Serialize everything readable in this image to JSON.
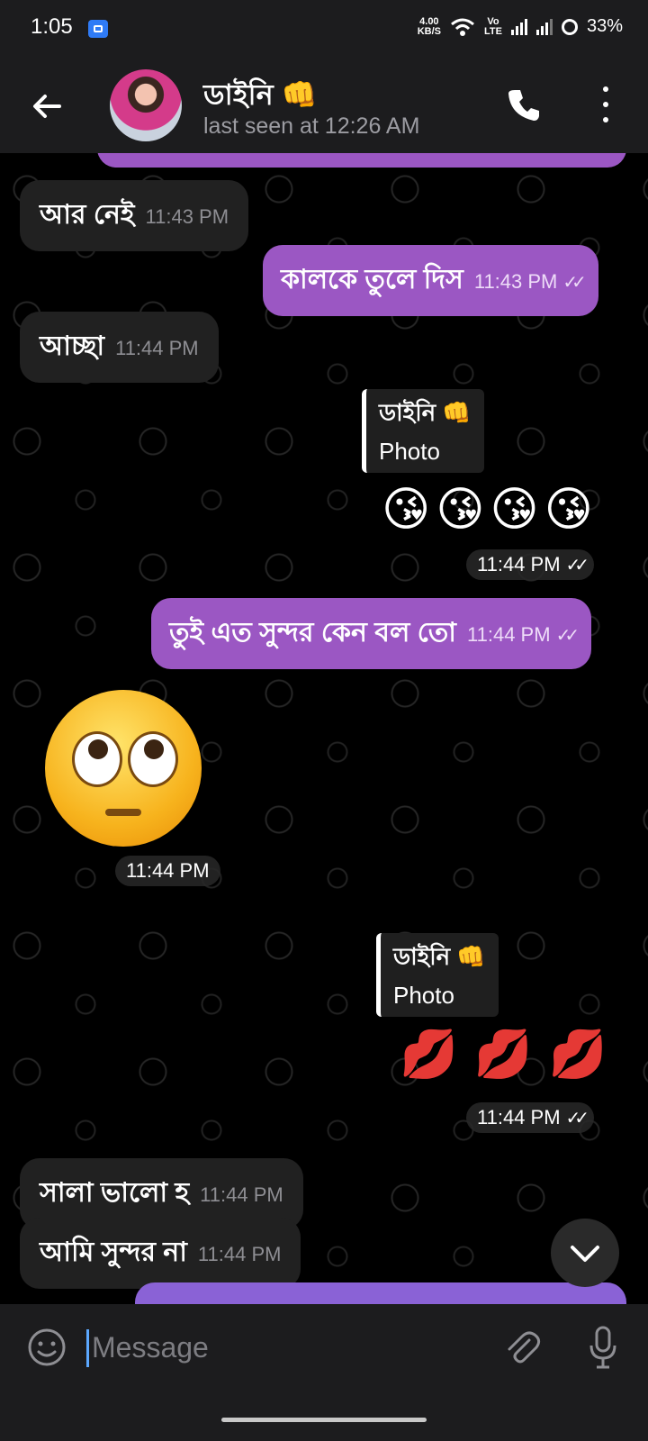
{
  "status_bar": {
    "time": "1:05",
    "net_speed_value": "4.00",
    "net_speed_unit": "KB/S",
    "volte": "Vo\nLTE",
    "battery": "33%"
  },
  "header": {
    "contact_name": "ডাইনি 👊",
    "last_seen": "last seen at 12:26 AM"
  },
  "messages": [
    {
      "text": "আর নেই",
      "time": "11:43 PM"
    },
    {
      "text": "কালকে তুলে দিস",
      "time": "11:43 PM"
    },
    {
      "text": "আচ্ছা",
      "time": "11:44 PM"
    },
    {
      "reply_name": "ডাইনি 👊",
      "reply_text": "Photo",
      "emojis": "😘😘😘😘",
      "time": "11:44 PM"
    },
    {
      "text": "তুই এত সুন্দর কেন বল তো",
      "time": "11:44 PM"
    },
    {
      "emoji": "🙄",
      "time": "11:44 PM"
    },
    {
      "reply_name": "ডাইনি 👊",
      "reply_text": "Photo",
      "emojis": "💋💋💋",
      "time": "11:44 PM"
    },
    {
      "text": "সালা ভালো হ",
      "time": "11:44 PM"
    },
    {
      "text": "আমি সুন্দর না",
      "time": "11:44 PM"
    }
  ],
  "input": {
    "placeholder": "Message"
  },
  "colors": {
    "outgoing_bubble": "#9b57c3",
    "incoming_bubble": "#212121",
    "bar_background": "#1c1c1e"
  }
}
